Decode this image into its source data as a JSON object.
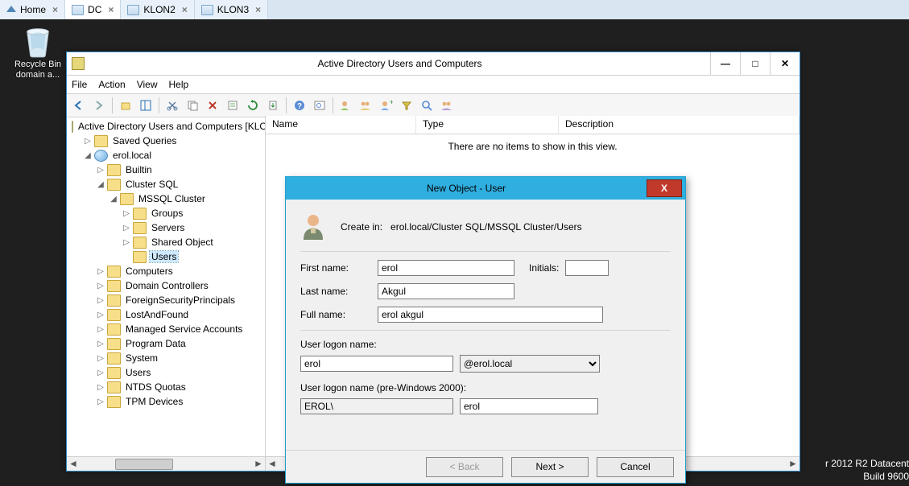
{
  "tabs": [
    {
      "label": "Home",
      "kind": "home"
    },
    {
      "label": "DC",
      "kind": "host",
      "active": true
    },
    {
      "label": "KLON2",
      "kind": "host"
    },
    {
      "label": "KLON3",
      "kind": "host"
    }
  ],
  "desktop": {
    "recycle_label": "Recycle Bin domain a..."
  },
  "watermark": {
    "line1": "r 2012 R2 Datacent",
    "line2": "Build 9600"
  },
  "adwin": {
    "title": "Active Directory Users and Computers",
    "menus": [
      "File",
      "Action",
      "View",
      "Help"
    ],
    "columns": {
      "name": "Name",
      "type": "Type",
      "desc": "Description"
    },
    "empty": "There are no items to show in this view."
  },
  "tree": {
    "root": "Active Directory Users and Computers [KLO",
    "saved": "Saved Queries",
    "domain": "erol.local",
    "builtin": "Builtin",
    "clustersql": "Cluster SQL",
    "mssql": "MSSQL Cluster",
    "groups": "Groups",
    "servers": "Servers",
    "shared": "Shared Object",
    "users_ou": "Users",
    "computers": "Computers",
    "dcs": "Domain Controllers",
    "fsp": "ForeignSecurityPrincipals",
    "laf": "LostAndFound",
    "msa": "Managed Service Accounts",
    "pdata": "Program Data",
    "system": "System",
    "users": "Users",
    "ntds": "NTDS Quotas",
    "tpm": "TPM Devices"
  },
  "dialog": {
    "title": "New Object - User",
    "create_in_label": "Create in:",
    "create_in_path": "erol.local/Cluster SQL/MSSQL Cluster/Users",
    "labels": {
      "first": "First name:",
      "initials": "Initials:",
      "last": "Last name:",
      "full": "Full name:",
      "logon": "User logon name:",
      "logon2000": "User logon name (pre-Windows 2000):"
    },
    "values": {
      "first": "erol",
      "initials": "",
      "last": "Akgul",
      "full": "erol akgul",
      "logon": "erol",
      "suffix": "@erol.local",
      "nbdomain": "EROL\\",
      "nbuser": "erol"
    },
    "buttons": {
      "back": "< Back",
      "next": "Next >",
      "cancel": "Cancel"
    }
  }
}
